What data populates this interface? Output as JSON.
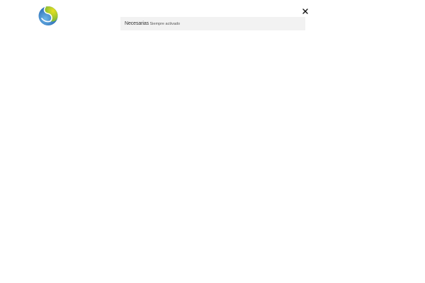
{
  "logo": {
    "icon": "globe-s-logo-icon",
    "colors": {
      "blue": "#1f6fc4",
      "light_blue": "#6db6e8",
      "green": "#8cc63f",
      "yellow": "#e8e020"
    }
  },
  "dialog": {
    "close_icon": "close-icon",
    "categories": [
      {
        "title": "Necesarias",
        "status": "Siempre activado",
        "background": "#f2f2f2"
      }
    ]
  }
}
